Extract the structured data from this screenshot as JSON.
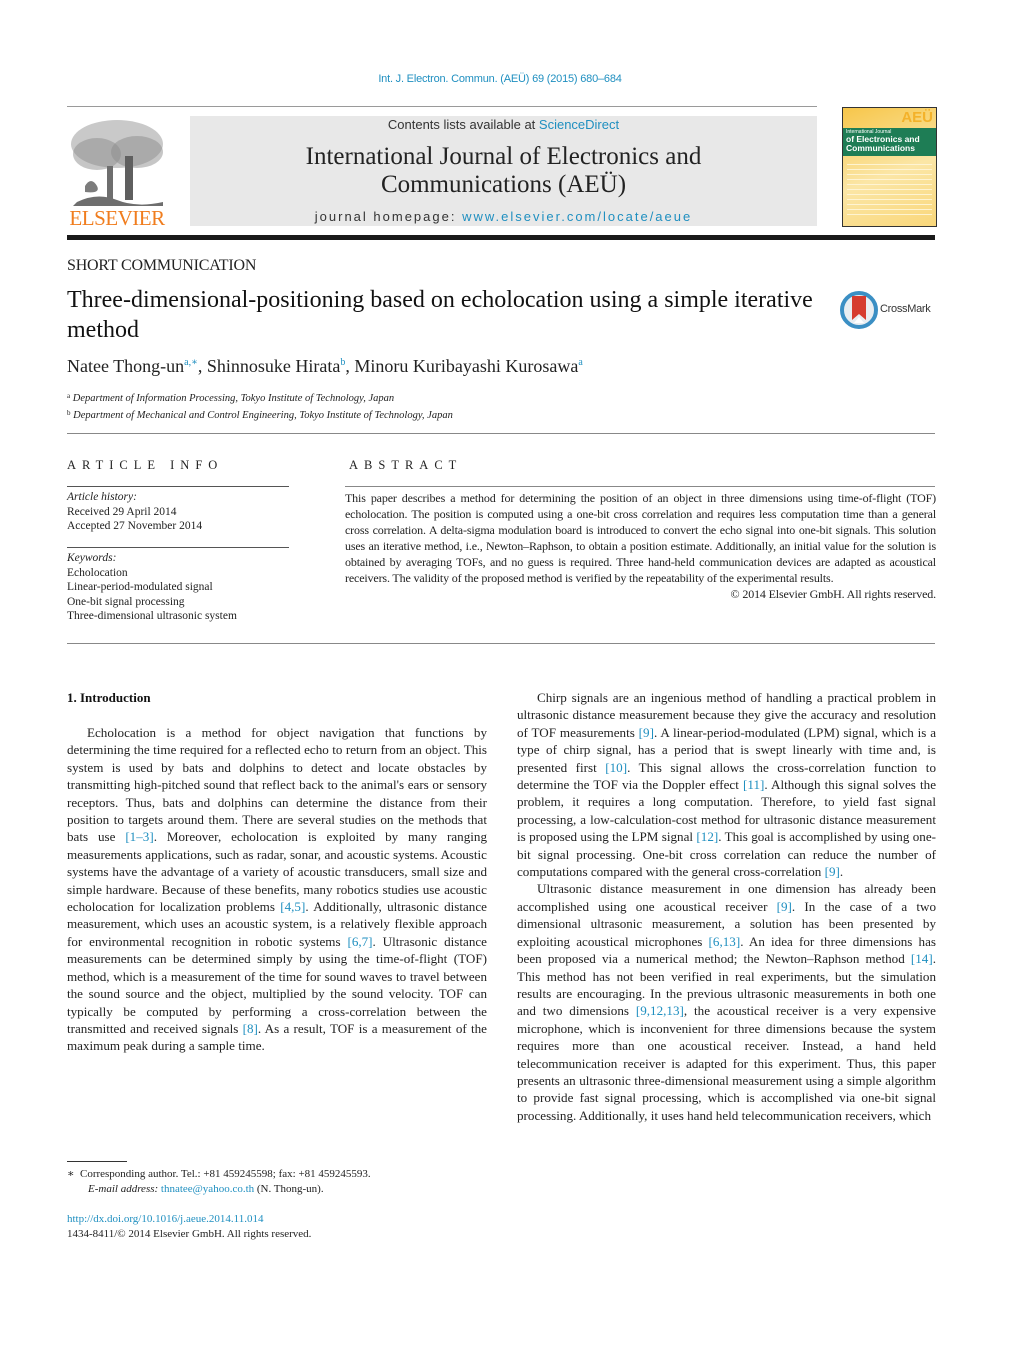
{
  "header": {
    "citation": "Int. J. Electron. Commun. (AEÜ) 69 (2015) 680–684",
    "contents_prefix": "Contents lists available at ",
    "contents_link": "ScienceDirect",
    "journal_title_line1": "International Journal of Electronics and",
    "journal_title_line2": "Communications (AEÜ)",
    "homepage_prefix": "journal homepage: ",
    "homepage_link": "www.elsevier.com/locate/aeue",
    "publisher_logo_text": "ELSEVIER",
    "cover": {
      "badge": "AEÜ",
      "line1": "International Journal",
      "line2a": "of Electronics and",
      "line2b": "Communications"
    }
  },
  "article": {
    "type": "SHORT COMMUNICATION",
    "title": "Three-dimensional-positioning based on echolocation using a simple iterative method",
    "crossmark_label": "CrossMark",
    "authors": [
      {
        "name": "Natee Thong-un",
        "sup": "a,∗",
        "sep": ", "
      },
      {
        "name": "Shinnosuke Hirata",
        "sup": "b",
        "sep": ", "
      },
      {
        "name": "Minoru Kuribayashi Kurosawa",
        "sup": "a",
        "sep": ""
      }
    ],
    "affiliations": [
      {
        "mark": "a",
        "text": "Department of Information Processing, Tokyo Institute of Technology, Japan"
      },
      {
        "mark": "b",
        "text": "Department of Mechanical and Control Engineering, Tokyo Institute of Technology, Japan"
      }
    ]
  },
  "article_info": {
    "heading": "ARTICLE INFO",
    "history_label": "Article history:",
    "received": "Received 29 April 2014",
    "accepted": "Accepted 27 November 2014",
    "keywords_label": "Keywords:",
    "keywords": [
      "Echolocation",
      "Linear-period-modulated signal",
      "One-bit signal processing",
      "Three-dimensional ultrasonic system"
    ]
  },
  "abstract": {
    "heading": "ABSTRACT",
    "text": "This paper describes a method for determining the position of an object in three dimensions using time-of-flight (TOF) echolocation. The position is computed using a one-bit cross correlation and requires less computation time than a general cross correlation. A delta-sigma modulation board is introduced to convert the echo signal into one-bit signals. This solution uses an iterative method, i.e., Newton–Raphson, to obtain a position estimate. Additionally, an initial value for the solution is obtained by averaging TOFs, and no guess is required. Three hand-held communication devices are adapted as acoustical receivers. The validity of the proposed method is verified by the repeatability of the experimental results.",
    "copyright": "© 2014 Elsevier GmbH. All rights reserved."
  },
  "body": {
    "section_heading": "1.  Introduction",
    "left_paragraph": [
      {
        "t": "Echolocation is a method for object navigation that functions by determining the time required for a reflected echo to return from an object. This system is used by bats and dolphins to detect and locate obstacles by transmitting high-pitched sound that reflect back to the animal's ears or sensory receptors. Thus, bats and dolphins can determine the distance from their position to targets around them. There are several studies on the methods that bats use "
      },
      {
        "ref": "[1–3]"
      },
      {
        "t": ". Moreover, echolocation is exploited by many ranging measurements applications, such as radar, sonar, and acoustic systems. Acoustic systems have the advantage of a variety of acoustic transducers, small size and simple hardware. Because of these benefits, many robotics studies use acoustic echolocation for localization problems "
      },
      {
        "ref": "[4,5]"
      },
      {
        "t": ". Additionally, ultrasonic distance measurement, which uses an acoustic system, is a relatively flexible approach for environmental recognition in robotic systems "
      },
      {
        "ref": "[6,7]"
      },
      {
        "t": ". Ultrasonic distance measurements can be determined simply by using the time-of-flight (TOF) method, which is a measurement of the time for sound waves to travel between the sound source and the object, multiplied by the sound velocity. TOF can typically be computed by performing a cross-correlation between the transmitted and received signals "
      },
      {
        "ref": "[8]"
      },
      {
        "t": ". As a result, TOF is a measurement of the maximum peak during a sample time."
      }
    ],
    "right_paragraph_1": [
      {
        "t": "Chirp signals are an ingenious method of handling a practical problem in ultrasonic distance measurement because they give the accuracy and resolution of TOF measurements "
      },
      {
        "ref": "[9]"
      },
      {
        "t": ". A linear-period-modulated (LPM) signal, which is a type of chirp signal, has a period that is swept linearly with time and, is presented first "
      },
      {
        "ref": "[10]"
      },
      {
        "t": ". This signal allows the cross-correlation function to determine the TOF via the Doppler effect "
      },
      {
        "ref": "[11]"
      },
      {
        "t": ". Although this signal solves the problem, it requires a long computation. Therefore, to yield fast signal processing, a low-calculation-cost method for ultrasonic distance measurement is proposed using the LPM signal "
      },
      {
        "ref": "[12]"
      },
      {
        "t": ". This goal is accomplished by using one-bit signal processing. One-bit cross correlation can reduce the number of computations compared with the general cross-correlation "
      },
      {
        "ref": "[9]"
      },
      {
        "t": "."
      }
    ],
    "right_paragraph_2": [
      {
        "t": "Ultrasonic distance measurement in one dimension has already been accomplished using one acoustical receiver "
      },
      {
        "ref": "[9]"
      },
      {
        "t": ". In the case of a two dimensional ultrasonic measurement, a solution has been presented by exploiting acoustical microphones "
      },
      {
        "ref": "[6,13]"
      },
      {
        "t": ". An idea for three dimensions has been proposed via a numerical method; the Newton–Raphson method "
      },
      {
        "ref": "[14]"
      },
      {
        "t": ". This method has not been verified in real experiments, but the simulation results are encouraging. In the previous ultrasonic measurements in both one and two dimensions "
      },
      {
        "ref": "[9,12,13]"
      },
      {
        "t": ", the acoustical receiver is a very expensive microphone, which is inconvenient for three dimensions because the system requires more than one acoustical receiver. Instead, a hand held telecommunication receiver is adapted for this experiment. Thus, this paper presents an ultrasonic three-dimensional measurement using a simple algorithm to provide fast signal processing, which is accomplished via one-bit signal processing. Additionally, it uses hand held telecommunication receivers, which"
      }
    ]
  },
  "footnote": {
    "mark": "∗",
    "corresponding": "Corresponding author. Tel.: +81 459245598; fax: +81 459245593.",
    "email_label": "E-mail address:",
    "email": "thnatee@yahoo.co.th",
    "email_suffix": " (N. Thong-un).",
    "doi": "http://dx.doi.org/10.1016/j.aeue.2014.11.014",
    "issn_line": "1434-8411/© 2014 Elsevier GmbH. All rights reserved."
  },
  "colors": {
    "link": "#1f8fc0",
    "elsevier_orange": "#f07d1e",
    "masthead_gray": "#e8e8e8",
    "cover_green": "#1e7d55",
    "cover_yellow": "#f7c64a",
    "crossmark_red": "#d63c2f",
    "crossmark_blue": "#3b8fc4"
  }
}
